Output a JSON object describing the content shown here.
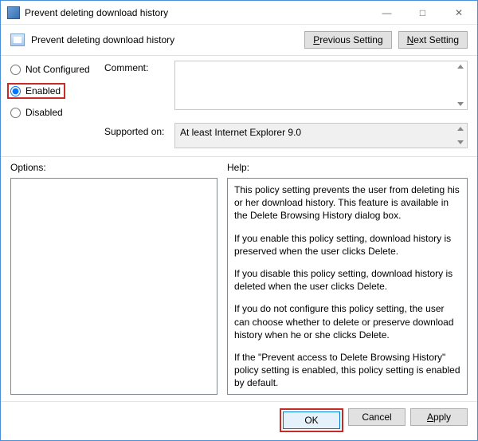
{
  "window": {
    "title": "Prevent deleting download history",
    "minimize": "—",
    "maximize": "□",
    "close": "✕"
  },
  "header": {
    "title": "Prevent deleting download history",
    "prev_label": "Previous Setting",
    "next_label": "Next Setting"
  },
  "radios": {
    "not_configured": "Not Configured",
    "enabled": "Enabled",
    "disabled": "Disabled",
    "selected": "enabled"
  },
  "comment": {
    "label": "Comment:",
    "value": ""
  },
  "supported": {
    "label": "Supported on:",
    "value": "At least Internet Explorer 9.0"
  },
  "options": {
    "label": "Options:"
  },
  "help": {
    "label": "Help:",
    "p1": "This policy setting prevents the user from deleting his or her download history. This feature is available in the Delete Browsing History dialog box.",
    "p2": "If you enable this policy setting, download history is preserved when the user clicks Delete.",
    "p3": "If you disable this policy setting, download history is deleted when the user clicks Delete.",
    "p4": "If you do not configure this policy setting, the user can choose whether to delete or preserve download history when he or she clicks Delete.",
    "p5": "If the \"Prevent access to Delete Browsing History\" policy setting is enabled, this policy setting is enabled by default."
  },
  "footer": {
    "ok": "OK",
    "cancel": "Cancel",
    "apply": "Apply"
  }
}
